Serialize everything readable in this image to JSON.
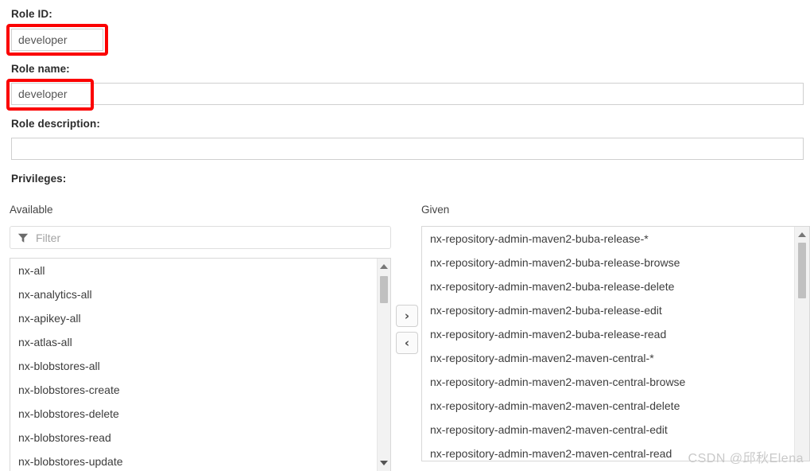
{
  "form": {
    "role_id": {
      "label": "Role ID:",
      "value": "developer",
      "placeholder": ""
    },
    "role_name": {
      "label": "Role name:",
      "value": "developer",
      "placeholder": ""
    },
    "role_description": {
      "label": "Role description:",
      "value": "",
      "placeholder": ""
    },
    "privileges_label": "Privileges:"
  },
  "privileges": {
    "available": {
      "label": "Available",
      "filter_placeholder": "Filter",
      "filter_value": "",
      "filter_icon": "funnel-icon",
      "items": [
        "nx-all",
        "nx-analytics-all",
        "nx-apikey-all",
        "nx-atlas-all",
        "nx-blobstores-all",
        "nx-blobstores-create",
        "nx-blobstores-delete",
        "nx-blobstores-read",
        "nx-blobstores-update"
      ]
    },
    "given": {
      "label": "Given",
      "items": [
        "nx-repository-admin-maven2-buba-release-*",
        "nx-repository-admin-maven2-buba-release-browse",
        "nx-repository-admin-maven2-buba-release-delete",
        "nx-repository-admin-maven2-buba-release-edit",
        "nx-repository-admin-maven2-buba-release-read",
        "nx-repository-admin-maven2-maven-central-*",
        "nx-repository-admin-maven2-maven-central-browse",
        "nx-repository-admin-maven2-maven-central-delete",
        "nx-repository-admin-maven2-maven-central-edit",
        "nx-repository-admin-maven2-maven-central-read"
      ]
    },
    "transfer": {
      "add_label": "›",
      "remove_label": "‹"
    }
  },
  "annotations": {
    "highlight_color": "#fb0000"
  },
  "watermark": "CSDN @邱秋Elena"
}
